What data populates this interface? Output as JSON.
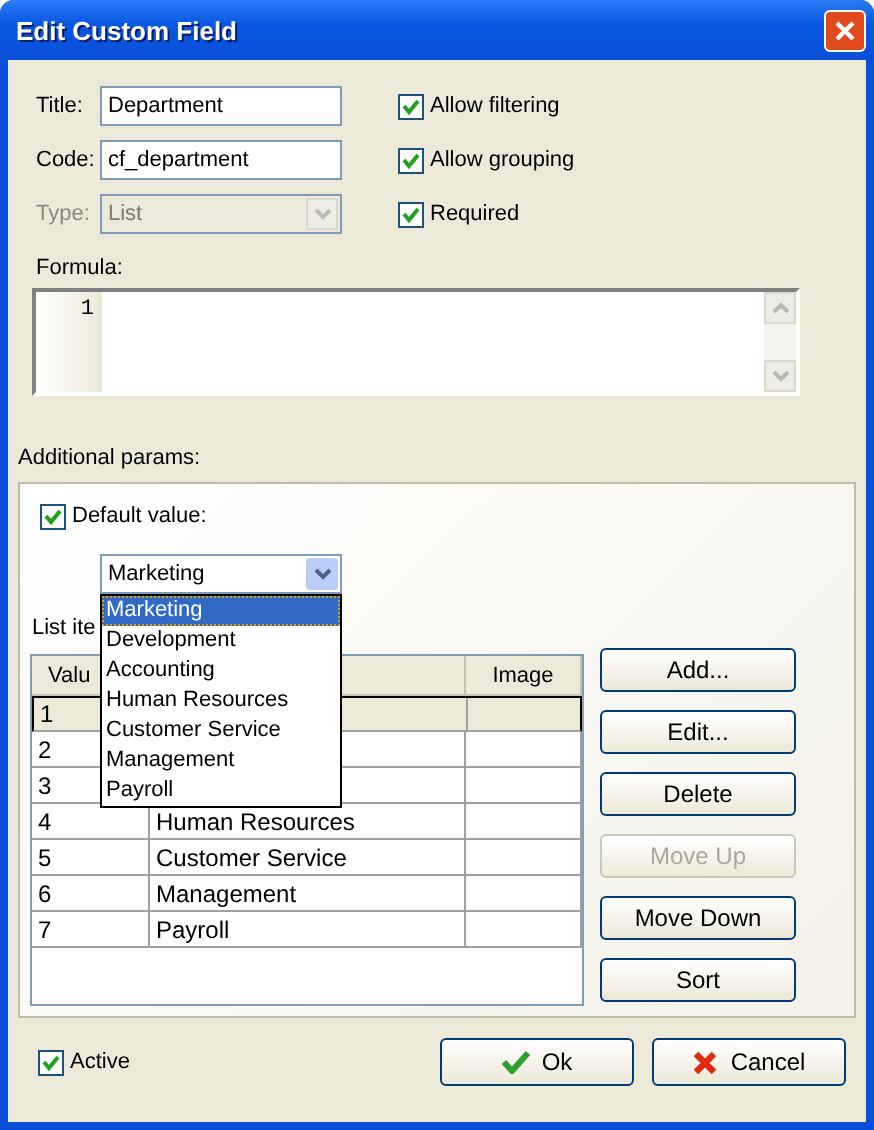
{
  "window": {
    "title": "Edit Custom Field"
  },
  "fields": [
    {
      "kind": "text",
      "label": "Title:",
      "value": "Department",
      "disabled": false
    },
    {
      "kind": "text",
      "label": "Code:",
      "value": "cf_department",
      "disabled": false
    },
    {
      "kind": "select",
      "label": "Type:",
      "value": "List",
      "disabled": true
    }
  ],
  "options": [
    {
      "label": "Allow filtering",
      "checked": true
    },
    {
      "label": "Allow grouping",
      "checked": true
    },
    {
      "label": "Required",
      "checked": true
    }
  ],
  "formula": {
    "label": "Formula:",
    "line_numbers": [
      "1"
    ]
  },
  "additional_params": {
    "label": "Additional params:",
    "default_value": {
      "label": "Default value:",
      "checked": true,
      "value": "Marketing",
      "dropdown": [
        {
          "label": "Marketing",
          "selected": true
        },
        {
          "label": "Development",
          "selected": false
        },
        {
          "label": "Accounting",
          "selected": false
        },
        {
          "label": "Human Resources",
          "selected": false
        },
        {
          "label": "Customer Service",
          "selected": false
        },
        {
          "label": "Management",
          "selected": false
        },
        {
          "label": "Payroll",
          "selected": false
        }
      ]
    },
    "list_label": "List ite",
    "table": {
      "columns": {
        "value": "Valu",
        "image": "Image"
      },
      "rows": [
        {
          "value": "1",
          "selected": true
        },
        {
          "value": "2",
          "selected": false
        },
        {
          "value": "3",
          "selected": false
        },
        {
          "value": "4",
          "name": "Human Resources",
          "selected": false
        },
        {
          "value": "5",
          "name": "Customer Service",
          "selected": false
        },
        {
          "value": "6",
          "name": "Management",
          "selected": false
        },
        {
          "value": "7",
          "name": "Payroll",
          "selected": false
        }
      ]
    },
    "buttons": [
      {
        "label": "Add...",
        "disabled": false
      },
      {
        "label": "Edit...",
        "disabled": false
      },
      {
        "label": "Delete",
        "disabled": false
      },
      {
        "label": "Move Up",
        "disabled": true
      },
      {
        "label": "Move Down",
        "disabled": false
      },
      {
        "label": "Sort",
        "disabled": false
      }
    ]
  },
  "active": {
    "label": "Active",
    "checked": true
  },
  "actions": [
    {
      "kind": "ok",
      "label": "Ok"
    },
    {
      "kind": "cancel",
      "label": "Cancel"
    }
  ]
}
